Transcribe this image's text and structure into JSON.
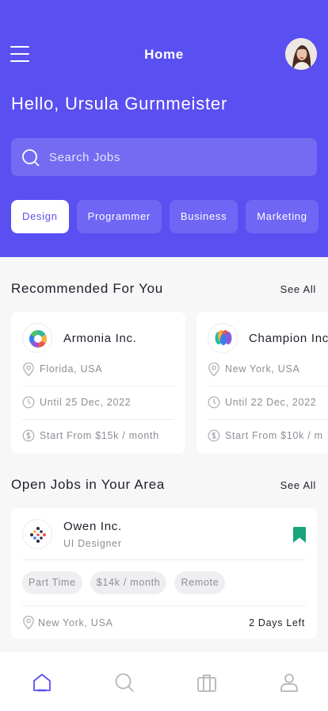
{
  "header": {
    "title": "Home",
    "greeting": "Hello, Ursula Gurnmeister",
    "search_placeholder": "Search Jobs"
  },
  "categories": [
    "Design",
    "Programmer",
    "Business",
    "Marketing"
  ],
  "active_category": "Design",
  "recommended": {
    "title": "Recommended For You",
    "see_all": "See All",
    "cards": [
      {
        "company": "Armonia Inc.",
        "location": "Florida, USA",
        "deadline": "Until 25 Dec, 2022",
        "salary": "Start From $15k / month"
      },
      {
        "company": "Champion Inc",
        "location": "New York, USA",
        "deadline": "Until 22 Dec, 2022",
        "salary": "Start From $10k / m"
      }
    ]
  },
  "open_jobs": {
    "title": "Open Jobs in Your Area",
    "see_all": "See All",
    "job": {
      "company": "Owen Inc.",
      "role": "UI Designer",
      "tags": [
        "Part Time",
        "$14k / month",
        "Remote"
      ],
      "location": "New York, USA",
      "days_left": "2 Days Left"
    }
  },
  "bottom_nav": {
    "items": [
      "home-icon",
      "search-icon",
      "briefcase-icon",
      "profile-icon"
    ],
    "active": "home-icon"
  },
  "colors": {
    "primary": "#5a4ff0",
    "chip": "#6f66f5",
    "bookmark": "#1aa37a",
    "muted": "#8d8d96"
  }
}
